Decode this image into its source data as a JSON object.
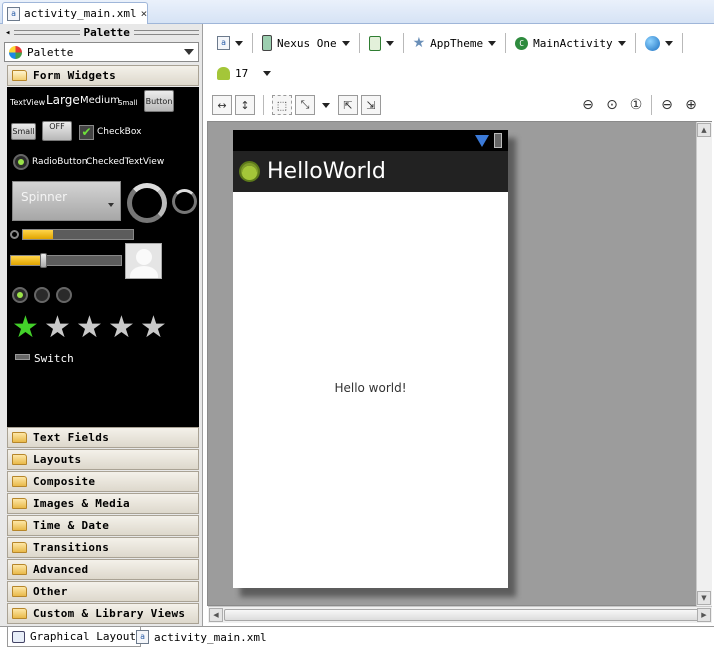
{
  "editor": {
    "tab_title": "activity_main.xml",
    "close_glyph": "×"
  },
  "palette": {
    "header": "Palette",
    "dropdown_value": "Palette",
    "open_category": "Form Widgets",
    "widgets": {
      "textview": "TextView",
      "large": "Large",
      "medium": "Medium",
      "small": "Small",
      "button": "Button",
      "small_button": "Small",
      "toggle": "OFF",
      "checkbox": "CheckBox",
      "radiobutton": "RadioButton",
      "checkedtextview": "CheckedTextView",
      "spinner": "Spinner",
      "switch": "Switch",
      "rating_stars": 1,
      "rating_max": 5,
      "progress_fraction": 0.27,
      "seek_fraction": 0.3
    },
    "categories": [
      "Text Fields",
      "Layouts",
      "Composite",
      "Images & Media",
      "Time & Date",
      "Transitions",
      "Advanced",
      "Other",
      "Custom & Library Views"
    ]
  },
  "toolbar": {
    "device": "Nexus One",
    "theme": "AppTheme",
    "activity": "MainActivity",
    "api_level": "17"
  },
  "device_preview": {
    "app_title": "HelloWorld",
    "content_text": "Hello world!"
  },
  "bottom_tabs": {
    "graphical": "Graphical Layout",
    "xml": "activity_main.xml"
  },
  "colors": {
    "canvas_bg": "#9c9c9c",
    "action_bar": "#222222",
    "progress_fill": "#f2b705"
  }
}
